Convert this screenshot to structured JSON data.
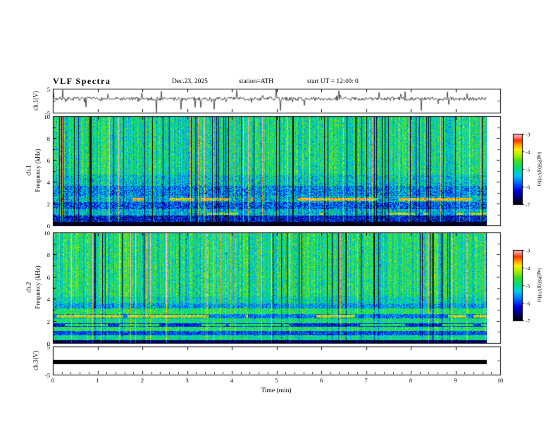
{
  "header": {
    "title": "VLF  Spectra",
    "date": "Dec.23, 2025",
    "station": "station=ATH",
    "start_ut": "start UT =   12:40: 0"
  },
  "chart_data": {
    "type": "heatmap",
    "title": "VLF Spectra",
    "xlabel": "Time  (min)",
    "x_range": [
      0,
      10
    ],
    "x_ticks": [
      "0",
      "1",
      "2",
      "3",
      "4",
      "5",
      "6",
      "7",
      "8",
      "9",
      "10"
    ],
    "x_minor_step_min": 0.2,
    "data_end_min": 9.7,
    "representation": "procedural-noise approximation of broadband VLF spectrogram",
    "colormap": [
      {
        "t": 0.0,
        "c": "#000000"
      },
      {
        "t": 0.09,
        "c": "#000066"
      },
      {
        "t": 0.2,
        "c": "#0000dd"
      },
      {
        "t": 0.32,
        "c": "#0077ff"
      },
      {
        "t": 0.42,
        "c": "#00ccee"
      },
      {
        "t": 0.52,
        "c": "#00dd77"
      },
      {
        "t": 0.62,
        "c": "#44dd22"
      },
      {
        "t": 0.7,
        "c": "#aaee00"
      },
      {
        "t": 0.78,
        "c": "#ffee00"
      },
      {
        "t": 0.85,
        "c": "#ff9900"
      },
      {
        "t": 0.91,
        "c": "#ff3300"
      },
      {
        "t": 0.96,
        "c": "#ff8888"
      },
      {
        "t": 1.0,
        "c": "#ffbbbb"
      }
    ],
    "panels": [
      {
        "id": "ch1-waveform",
        "type": "line",
        "ylabel": "ch.1(V)",
        "ylim": [
          -5,
          5
        ],
        "yticks": [
          5,
          -5
        ],
        "minor_yticks": [
          0
        ],
        "seed": 7,
        "baseline": 0.8,
        "noise": 0.75,
        "spike_down_prob": 0.05,
        "spike_up_prob": 0.035
      },
      {
        "id": "ch1-spectrogram",
        "type": "heatmap",
        "ylabel_line1": "ch.1",
        "ylabel_line2": "Frequency (kHz)",
        "ylim": [
          0,
          10
        ],
        "yticks": [
          10,
          8,
          6,
          4,
          2,
          0
        ],
        "minor_yticks": [
          9,
          7,
          5,
          3,
          1
        ],
        "value_range": [
          -7,
          -3
        ],
        "seed": 101,
        "bright_col_prob": 0.05,
        "dark_col_prob": 0.07,
        "bands": [
          {
            "f0": 0.0,
            "f1": 0.35,
            "base": -6.9,
            "noise": 0.25,
            "cf": 0.15
          },
          {
            "f0": 0.35,
            "f1": 0.95,
            "base": -6.2,
            "noise": 0.7,
            "cf": 0.5
          },
          {
            "f0": 0.95,
            "f1": 1.55,
            "base": -5.35,
            "noise": 0.65,
            "cf": 0.8
          },
          {
            "f0": 1.55,
            "f1": 2.15,
            "base": -5.85,
            "noise": 0.7,
            "cf": 0.6
          },
          {
            "f0": 2.15,
            "f1": 2.75,
            "base": -5.35,
            "noise": 0.7,
            "cf": 0.8
          },
          {
            "f0": 2.75,
            "f1": 3.65,
            "base": -5.6,
            "noise": 0.7,
            "cf": 0.7
          },
          {
            "f0": 3.65,
            "f1": 4.7,
            "base": -5.2,
            "noise": 0.65,
            "cf": 0.9
          },
          {
            "f0": 4.7,
            "f1": 10.01,
            "base": -4.95,
            "noise": 0.6,
            "cf": 1.0
          }
        ],
        "hsegs": [
          {
            "f": 2.45,
            "hw": 0.13,
            "boost": 1.7
          },
          {
            "f": 1.1,
            "hw": 0.1,
            "boost": 1.2
          }
        ]
      },
      {
        "id": "ch2-spectrogram",
        "type": "heatmap",
        "ylabel_line1": "ch.2",
        "ylabel_line2": "Frequency (kHz)",
        "ylim": [
          0,
          10
        ],
        "yticks": [
          10,
          8,
          6,
          4,
          2,
          0
        ],
        "minor_yticks": [
          9,
          7,
          5,
          3,
          1
        ],
        "value_range": [
          -7,
          -3
        ],
        "seed": 202,
        "bright_col_prob": 0.05,
        "dark_col_prob": 0.06,
        "bands": [
          {
            "f0": 0.0,
            "f1": 0.3,
            "base": -6.7,
            "noise": 0.4,
            "cf": 0.3
          },
          {
            "f0": 0.3,
            "f1": 0.75,
            "base": -5.0,
            "noise": 0.55,
            "cf": 0.35
          },
          {
            "f0": 0.75,
            "f1": 1.15,
            "base": -5.9,
            "noise": 0.5,
            "cf": 0.3
          },
          {
            "f0": 1.15,
            "f1": 1.5,
            "base": -4.8,
            "noise": 0.5,
            "cf": 0.3
          },
          {
            "f0": 1.5,
            "f1": 1.85,
            "base": -6.1,
            "noise": 0.5,
            "cf": 0.3
          },
          {
            "f0": 1.85,
            "f1": 2.25,
            "base": -4.9,
            "noise": 0.5,
            "cf": 0.3
          },
          {
            "f0": 2.25,
            "f1": 2.65,
            "base": -5.7,
            "noise": 0.55,
            "cf": 0.35
          },
          {
            "f0": 2.65,
            "f1": 3.15,
            "base": -4.8,
            "noise": 0.5,
            "cf": 0.4
          },
          {
            "f0": 3.15,
            "f1": 3.65,
            "base": -5.5,
            "noise": 0.6,
            "cf": 0.55
          },
          {
            "f0": 3.65,
            "f1": 4.25,
            "base": -5.1,
            "noise": 0.6,
            "cf": 0.8
          },
          {
            "f0": 4.25,
            "f1": 10.01,
            "base": -4.9,
            "noise": 0.6,
            "cf": 1.0
          }
        ],
        "hsegs": [
          {
            "f": 2.45,
            "hw": 0.12,
            "boost": 1.6
          },
          {
            "f": 1.65,
            "hw": 0.09,
            "boost": 1.3
          }
        ]
      },
      {
        "id": "ch3-waveform",
        "type": "line",
        "ylabel": "ch.3(V)",
        "ylim": [
          -5,
          5
        ],
        "yticks": [
          5,
          -5
        ],
        "minor_yticks": [
          0
        ],
        "flat_value": -0.4,
        "line_thickness_px": 6
      }
    ],
    "colorbars": [
      {
        "label": "log(PSD)(V²/Hz)",
        "ticks": [
          "-3",
          "-4",
          "-5",
          "-6",
          "-7"
        ],
        "range": [
          -7,
          -3
        ]
      },
      {
        "label": "log(PSD)(V²/Hz)",
        "ticks": [
          "-3",
          "-4",
          "-5",
          "-6",
          "-7"
        ],
        "range": [
          -7,
          -3
        ]
      }
    ]
  }
}
